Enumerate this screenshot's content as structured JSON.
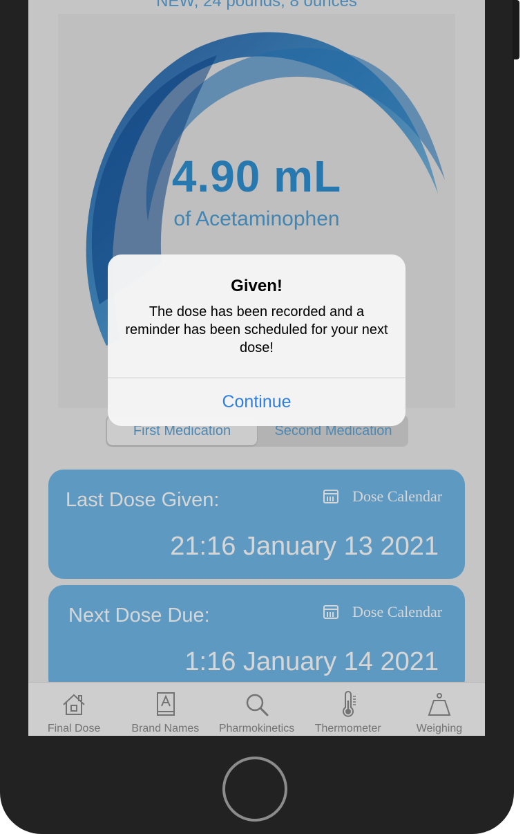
{
  "header": {
    "subtitle": "NEW, 24 pounds, 8 ounces"
  },
  "dose": {
    "amount": "4.90 mL",
    "medication": "of Acetaminophen"
  },
  "segmented_control": {
    "first": "First Medication",
    "second": "Second Medication",
    "selected": "First Medication"
  },
  "last_dose": {
    "title": "Last Dose Given:",
    "calendar_label": "Dose Calendar",
    "value": "21:16 January 13 2021"
  },
  "next_dose": {
    "title": "Next Dose Due:",
    "calendar_label": "Dose Calendar",
    "value": "1:16 January 14 2021"
  },
  "tabs": [
    {
      "label": "Final Dose",
      "icon": "house-icon"
    },
    {
      "label": "Brand Names",
      "icon": "book-icon"
    },
    {
      "label": "Pharmokinetics",
      "icon": "search-icon"
    },
    {
      "label": "Thermometer",
      "icon": "thermometer-icon"
    },
    {
      "label": "Weighing",
      "icon": "scale-icon"
    }
  ],
  "alert": {
    "title": "Given!",
    "message": "The dose has been recorded and a reminder has been scheduled for your next dose!",
    "button": "Continue"
  },
  "colors": {
    "accent": "#2f8fd0",
    "card": "#6fb7e6",
    "alert_button": "#2f7fe0"
  }
}
